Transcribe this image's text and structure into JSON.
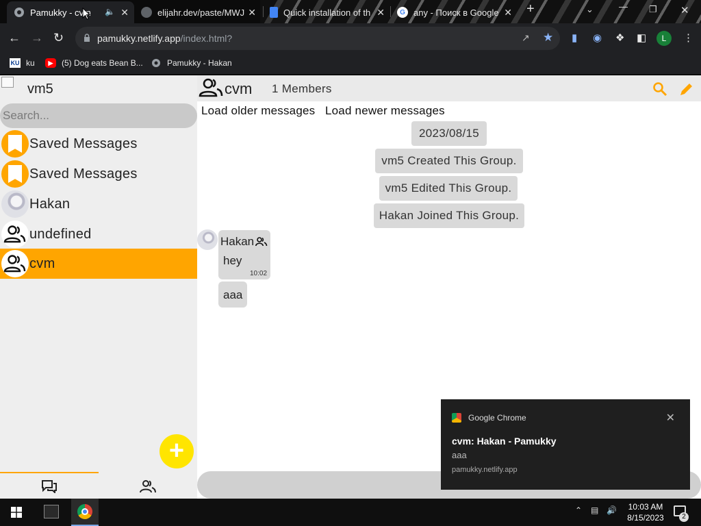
{
  "browser": {
    "tabs": [
      {
        "title": "Pamukky - cvm",
        "active": true,
        "audio": true
      },
      {
        "title": "elijahr.dev/paste/MWJ",
        "active": false
      },
      {
        "title": "Quick installation of th",
        "active": false
      },
      {
        "title": "any - Поиск в Google",
        "active": false
      }
    ],
    "new_tab": "+",
    "url_domain": "pamukky.netlify.app",
    "url_path": "/index.html?",
    "profile_initial": "L",
    "bookmarks": [
      {
        "label": "ku",
        "icon": "KU"
      },
      {
        "label": "(5) Dog eats Bean B...",
        "icon": "youtube-icon"
      },
      {
        "label": "Pamukky - Hakan",
        "icon": "globe-icon"
      }
    ]
  },
  "sidebar": {
    "user_name": "vm5",
    "search_placeholder": "Search...",
    "chats": [
      {
        "label": "Saved Messages",
        "avatar": "bookmark-icon",
        "active": false
      },
      {
        "label": "Saved Messages",
        "avatar": "bookmark-icon",
        "active": false
      },
      {
        "label": "Hakan",
        "avatar": "user-photo",
        "active": false
      },
      {
        "label": "undefined",
        "avatar": "group-icon",
        "active": false
      },
      {
        "label": "cvm",
        "avatar": "group-icon",
        "active": true
      }
    ],
    "fab_label": "+",
    "accent": "#ffa500"
  },
  "chat": {
    "title": "cvm",
    "members": "1 Members",
    "load_older": "Load older messages",
    "load_newer": "Load newer messages",
    "system_messages": [
      "2023/08/15",
      "vm5 Created This Group.",
      "vm5 Edited This Group.",
      "Hakan Joined This Group."
    ],
    "messages": [
      {
        "sender": "Hakan",
        "text": "hey",
        "time": "10:02"
      },
      {
        "sender": "",
        "text": "aaa",
        "time": ""
      }
    ]
  },
  "notification": {
    "app": "Google Chrome",
    "title": "cvm: Hakan - Pamukky",
    "body": "aaa",
    "source": "pamukky.netlify.app"
  },
  "taskbar": {
    "time": "10:03 AM",
    "date": "8/15/2023",
    "notifications_count": "2"
  }
}
